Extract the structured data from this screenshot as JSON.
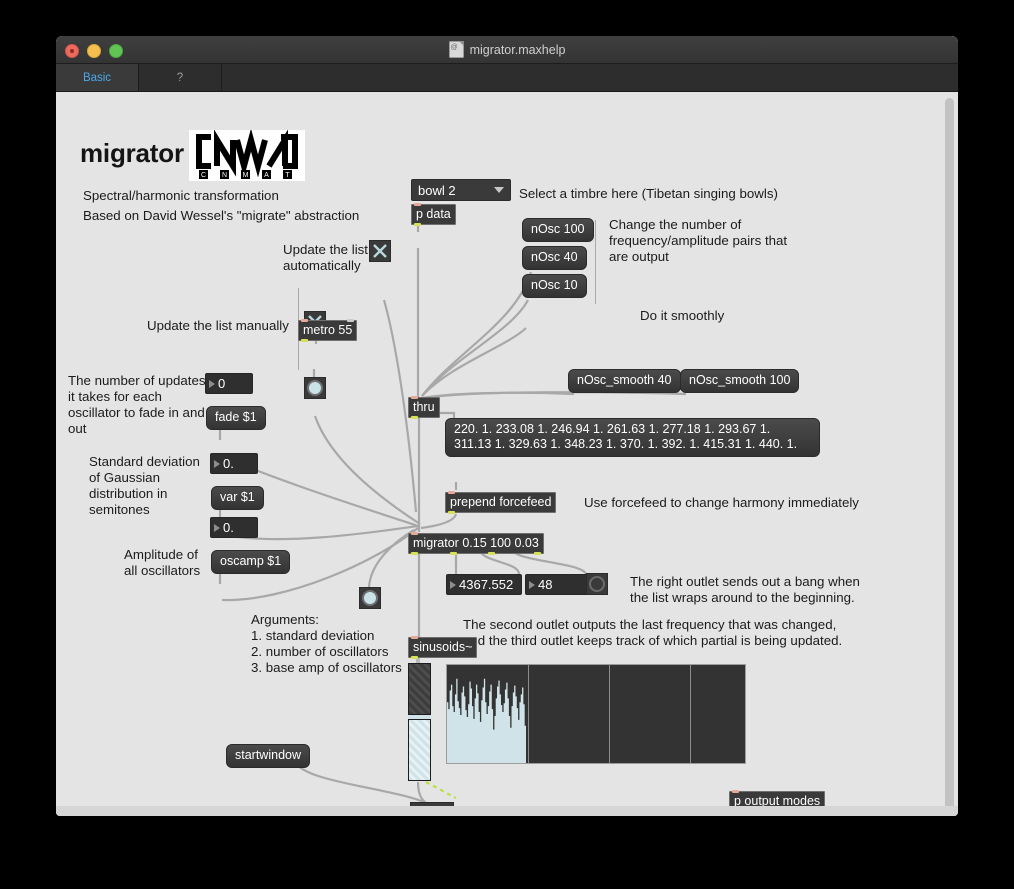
{
  "window": {
    "title": "migrator.maxhelp",
    "doc_icon": "document-icon"
  },
  "tabs": [
    {
      "label": "Basic",
      "active": true
    },
    {
      "label": "?",
      "active": false
    }
  ],
  "header": {
    "title": "migrator",
    "logo_alt": "CNMAT",
    "logo_letters": [
      "C",
      "N",
      "M",
      "A",
      "T"
    ],
    "subtitle_1": "Spectral/harmonic transformation",
    "subtitle_2": "Based on David Wessel's \"migrate\" abstraction"
  },
  "patch": {
    "umenu_value": "bowl 2",
    "comment_timbre": "Select a timbre here (Tibetan singing bowls)",
    "obj_p_data": "p data",
    "msg_nosc_100": "nOsc 100",
    "msg_nosc_40": "nOsc 40",
    "msg_nosc_10": "nOsc 10",
    "comment_nosc": "Change the number of\nfrequency/amplitude pairs that\nare output",
    "comment_smooth": "Do it smoothly",
    "msg_nosc_smooth_40": "nOsc_smooth 40",
    "msg_nosc_smooth_100": "nOsc_smooth 100",
    "comment_auto": "Update the list\nautomatically",
    "comment_manual": "Update the list manually",
    "obj_metro": "metro 55",
    "comment_fade": "The number of updates\nit takes for each\noscillator to fade in and\nout",
    "num_fade": "0",
    "msg_fade": "fade $1",
    "comment_var": "Standard deviation\nof Gaussian\ndistribution in\nsemitones",
    "num_var": "0.",
    "msg_var": "var $1",
    "comment_oscamp": "Amplitude of\nall oscillators",
    "num_oscamp": "0.",
    "msg_oscamp": "oscamp $1",
    "obj_thru": "thru",
    "msg_list": "220. 1. 233.08 1. 246.94 1. 261.63 1. 277.18 1. 293.67 1. 311.13 1. 329.63 1. 348.23 1. 370. 1. 392. 1. 415.31 1. 440. 1.",
    "obj_prepend": "prepend forcefeed",
    "comment_forcefeed": "Use forcefeed to change harmony immediately",
    "obj_migrator": "migrator 0.15 100 0.03",
    "num_freq": "4367.552",
    "num_partial": "48",
    "comment_right_outlet": "The right outlet sends out a bang when\nthe list wraps around to the beginning.",
    "comment_outlets": "The second outlet outputs the last frequency that was changed,\nand the third outlet keeps track of which partial is being updated.",
    "comment_arguments": "Arguments:\n1. standard deviation\n2. number of oscillators\n3. base amp of oscillators",
    "obj_sinusoids": "sinusoids~",
    "msg_startwindow": "startwindow",
    "obj_p_output_modes": "p output modes",
    "icons": {
      "toggle_auto": "x-toggle-icon",
      "toggle_manual": "x-toggle-icon",
      "bang_manual": "bang-icon",
      "bang_wrap": "bang-icon",
      "bang_migrate": "bang-icon",
      "dac": "speaker-icon",
      "caret": "chevron-down-icon"
    }
  },
  "colors": {
    "accent_tab": "#4aa8e8",
    "canvas_bg": "#e4e4e4",
    "object_bg": "#3a3a3a",
    "object_border": "#6f6f6f",
    "wire": "#a8a8a8",
    "signal_accent": "#bbe043",
    "spectrum_fill": "#cfe3e8",
    "inlet": "#e8a99a",
    "outlet": "#d8e05a"
  },
  "spectrum": {
    "panels": 4,
    "active_panel": 0,
    "bars": [
      62,
      55,
      74,
      80,
      58,
      52,
      70,
      86,
      63,
      56,
      49,
      72,
      78,
      68,
      54,
      47,
      60,
      83,
      76,
      58,
      45,
      66,
      80,
      71,
      52,
      42,
      64,
      77,
      86,
      62,
      50,
      58,
      73,
      80,
      55,
      34,
      48,
      66,
      78,
      84,
      70,
      59,
      52,
      61,
      75,
      82,
      66,
      48,
      36,
      58,
      72,
      79,
      68,
      56,
      44,
      62,
      70,
      77,
      60,
      38
    ]
  }
}
